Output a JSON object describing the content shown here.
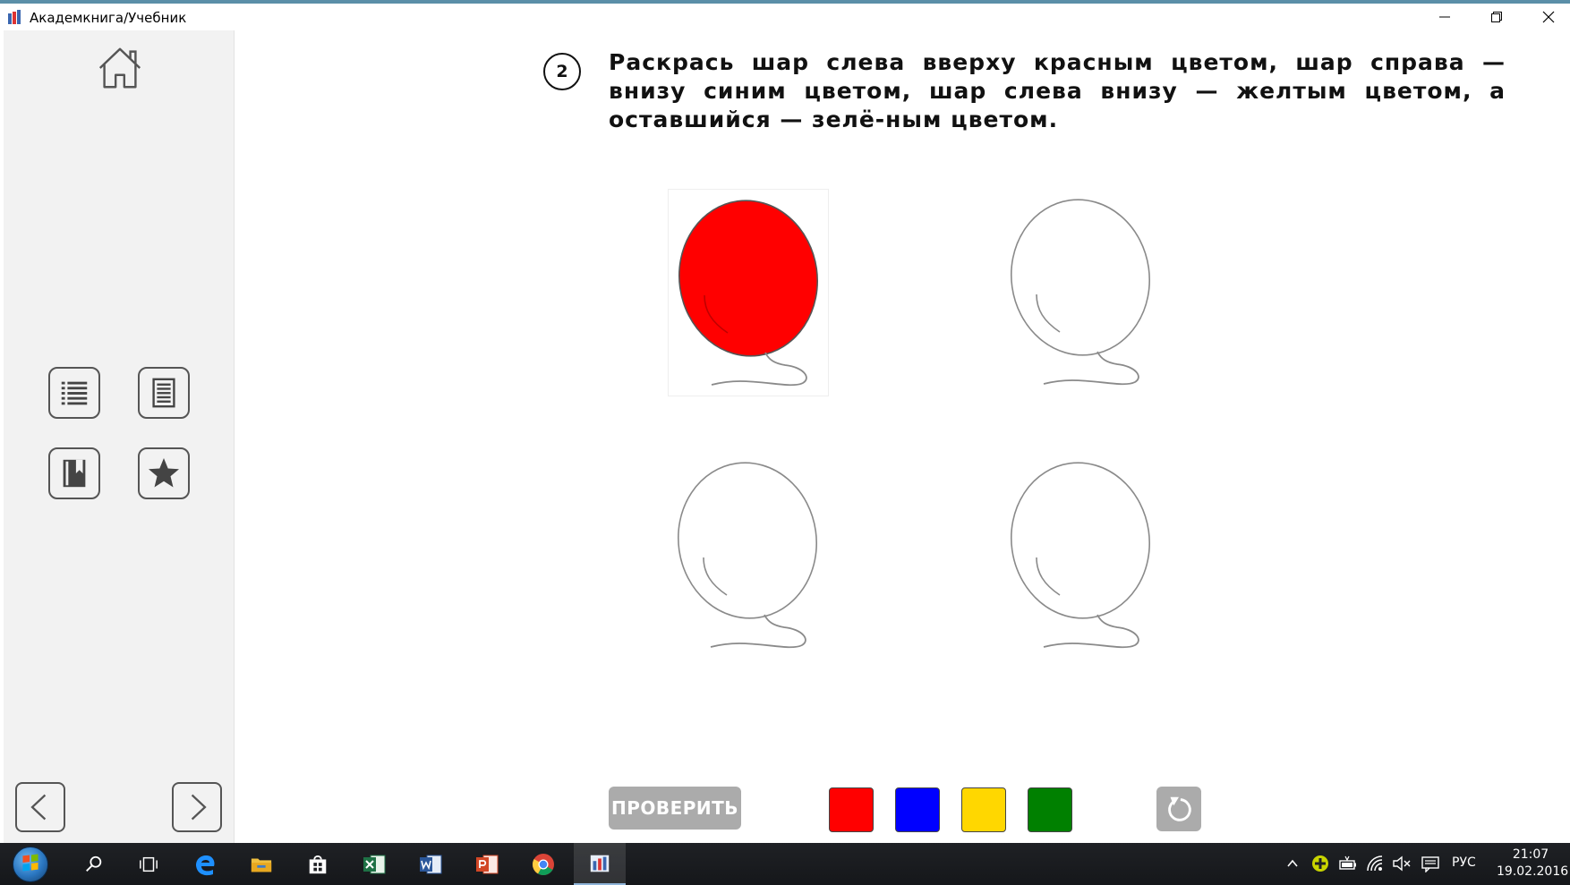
{
  "window": {
    "title": "Академкнига/Учебник"
  },
  "task": {
    "number": "2",
    "instruction": "Раскрась шар слева вверху красным цветом, шар справа — внизу синим цветом, шар слева внизу — желтым цветом, а оставшийся — зелё-ным цветом."
  },
  "balloons": [
    {
      "position": "top-left",
      "fill": "#ff0000"
    },
    {
      "position": "top-right",
      "fill": "none"
    },
    {
      "position": "bottom-left",
      "fill": "none"
    },
    {
      "position": "bottom-right",
      "fill": "none"
    }
  ],
  "controls": {
    "check_label": "ПРОВЕРИТЬ"
  },
  "palette": [
    {
      "name": "red",
      "color": "#ff0000"
    },
    {
      "name": "blue",
      "color": "#0000ff"
    },
    {
      "name": "yellow",
      "color": "#ffd700"
    },
    {
      "name": "green",
      "color": "#008000"
    }
  ],
  "sidebar": {
    "buttons": [
      "home-icon",
      "list-icon",
      "document-icon",
      "bookmark-book-icon",
      "star-icon",
      "arrow-left-icon",
      "arrow-right-icon"
    ]
  },
  "taskbar": {
    "apps": [
      "search-icon",
      "task-view-icon",
      "edge-icon",
      "file-explorer-icon",
      "store-icon",
      "excel-icon",
      "word-icon",
      "powerpoint-icon",
      "chrome-icon",
      "akademkniga-icon"
    ],
    "language": "РУС",
    "time": "21:07",
    "date": "19.02.2016"
  }
}
